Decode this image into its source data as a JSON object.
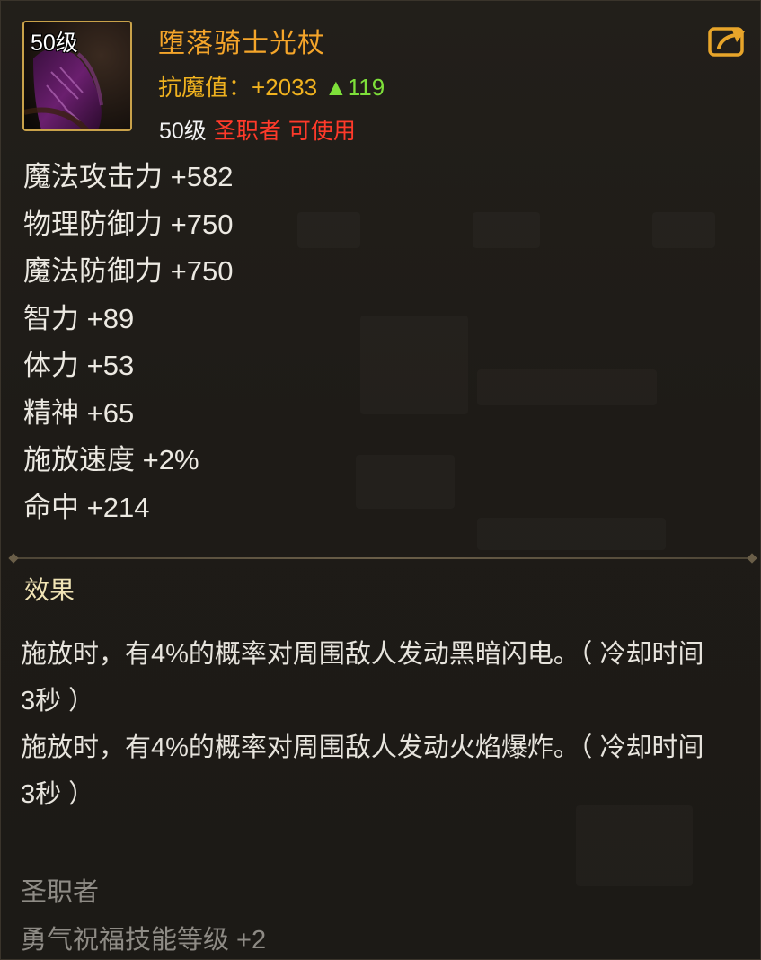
{
  "item": {
    "icon_level": "50级",
    "name": "堕落骑士光杖",
    "resist_label": "抗魔值：",
    "resist_value": "+2033",
    "resist_increase": "▲119",
    "required_level": "50级",
    "required_class": "圣职者",
    "usable_text": "可使用",
    "icon": "dark-staff-icon",
    "share_icon": "share-arrow-icon"
  },
  "stats": [
    "魔法攻击力 +582",
    "物理防御力 +750",
    "魔法防御力 +750",
    "智力 +89",
    "体力 +53",
    "精神 +65",
    "施放速度 +2%",
    "命中 +214"
  ],
  "effects": {
    "title": "效果",
    "lines": [
      "施放时，有4%的概率对周围敌人发动黑暗闪电。（ 冷却时间3秒 ）",
      "施放时，有4%的概率对周围敌人发动火焰爆炸。（ 冷却时间3秒 ）"
    ]
  },
  "class_bonus": {
    "class_name": "圣职者",
    "bonus": "勇气祝福技能等级 +2"
  },
  "colors": {
    "name": "#f5a52a",
    "resist": "#f0b21f",
    "increase": "#7ee03a",
    "requirement_unmet": "#ff3a2a",
    "frame": "#c9a24a",
    "muted": "#8e8b85"
  }
}
